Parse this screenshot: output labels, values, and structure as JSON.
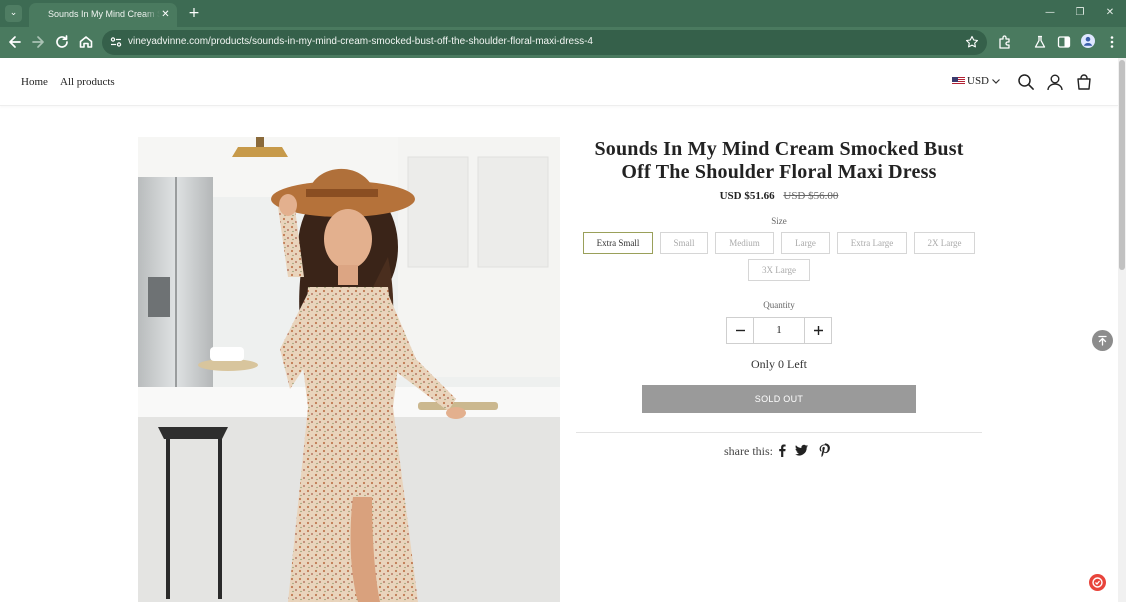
{
  "browser": {
    "tab_title": "Sounds In My Mind Cream Smocked Bust Off The Shoulder Floral Maxi Dress",
    "tab_close": "✕",
    "new_tab": "+",
    "url": "vineyadvinne.com/products/sounds-in-my-mind-cream-smocked-bust-off-the-shoulder-floral-maxi-dress-4",
    "window_controls": {
      "minimize": "—",
      "restore": "❐",
      "close": "✕"
    },
    "colors": {
      "frame": "#3d6b53",
      "toolbar": "#4a7a5f",
      "omnibox": "#35604a"
    }
  },
  "header": {
    "nav": [
      {
        "label": "Home"
      },
      {
        "label": "All products"
      }
    ],
    "currency": "USD",
    "icons": [
      "search-icon",
      "account-icon",
      "cart-icon"
    ]
  },
  "product": {
    "title": "Sounds In My Mind Cream Smocked Bust Off The Shoulder Floral Maxi Dress",
    "price": "USD $51.66",
    "compare_price": "USD $56.00",
    "size_label": "Size",
    "sizes": [
      {
        "label": "Extra Small",
        "selected": true
      },
      {
        "label": "Small",
        "selected": false
      },
      {
        "label": "Medium",
        "selected": false
      },
      {
        "label": "Large",
        "selected": false
      },
      {
        "label": "Extra Large",
        "selected": false
      },
      {
        "label": "2X Large",
        "selected": false
      },
      {
        "label": "3X Large",
        "selected": false
      }
    ],
    "quantity_label": "Quantity",
    "quantity": "1",
    "stock_text": "Only 0 Left",
    "sold_out_label": "SOLD OUT",
    "share_label": "share this:",
    "share_icons": [
      "facebook-icon",
      "twitter-icon",
      "pinterest-icon"
    ],
    "colors": {
      "selected_border": "#9aa05a",
      "button": "#9a9a9a"
    }
  },
  "floating": {
    "back_to_top_icon": "arrow-up-icon",
    "chat_icon": "chat-icon",
    "chat_color": "#e8443b"
  }
}
